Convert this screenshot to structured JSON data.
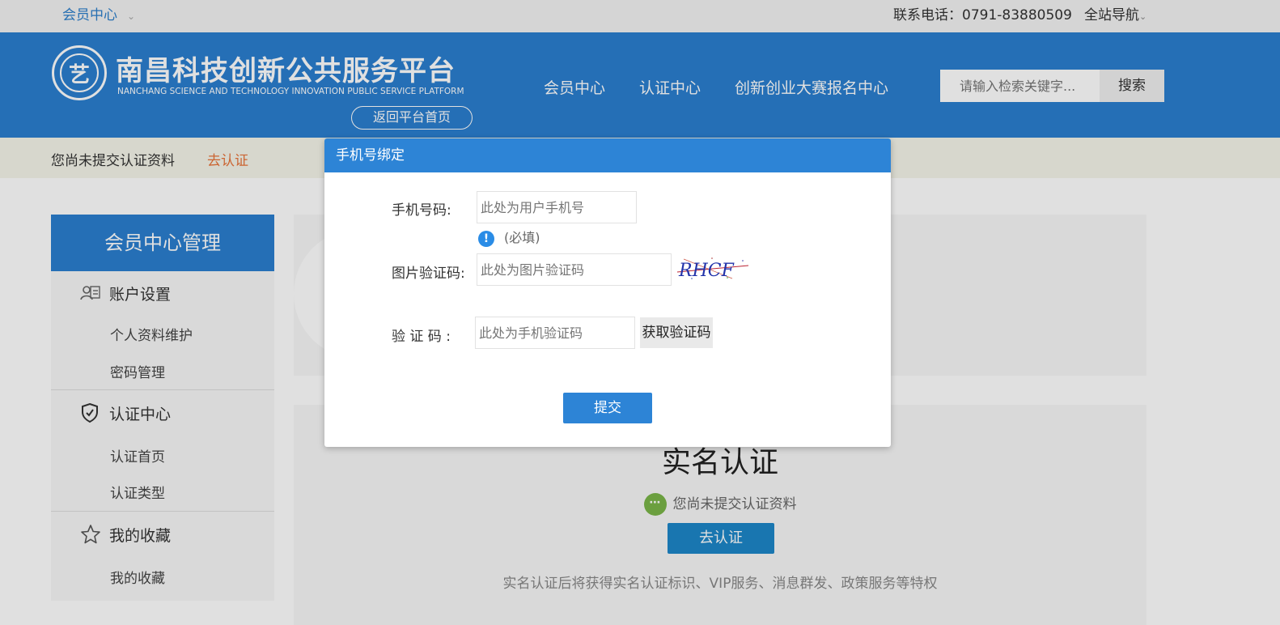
{
  "topbar": {
    "member_center": "会员中心",
    "phone": "联系电话：0791-83880509",
    "site_nav": "全站导航"
  },
  "header": {
    "logo_emblem_char": "艺",
    "logo_cn": "南昌科技创新公共服务平台",
    "logo_en": "NANCHANG SCIENCE AND TECHNOLOGY INNOVATION PUBLIC SERVICE PLATFORM",
    "back_home": "返回平台首页",
    "nav": [
      "会员中心",
      "认证中心",
      "创新创业大赛报名中心"
    ],
    "search_placeholder": "请输入检索关键字...",
    "search_button": "搜索"
  },
  "notice": {
    "text": "您尚未提交认证资料",
    "link": "去认证"
  },
  "sidebar": {
    "title": "会员中心管理",
    "groups": [
      {
        "label": "账户设置",
        "icon": "user-card-icon",
        "items": [
          "个人资料维护",
          "密码管理"
        ]
      },
      {
        "label": "认证中心",
        "icon": "shield-check-icon",
        "items": [
          "认证首页",
          "认证类型"
        ]
      },
      {
        "label": "我的收藏",
        "icon": "star-icon",
        "items": [
          "我的收藏"
        ]
      }
    ]
  },
  "main": {
    "real_name_title": "实名认证",
    "status_text": "您尚未提交认证资料",
    "go_button": "去认证",
    "benefit_text": "实名认证后将获得实名认证标识、VIP服务、消息群发、政策服务等特权"
  },
  "modal": {
    "title": "手机号绑定",
    "phone_label": "手机号码:",
    "phone_placeholder": "此处为用户手机号",
    "required_text": "(必填)",
    "captcha_label": "图片验证码:",
    "captcha_placeholder": "此处为图片验证码",
    "captcha_text": "RHCF",
    "sms_label": "验 证 码 :",
    "sms_placeholder": "此处为手机验证码",
    "sms_button": "获取验证码",
    "submit": "提交"
  },
  "colors": {
    "brand_blue": "#2b7fd0",
    "accent_orange": "#e8733a",
    "status_green": "#7ab648"
  }
}
